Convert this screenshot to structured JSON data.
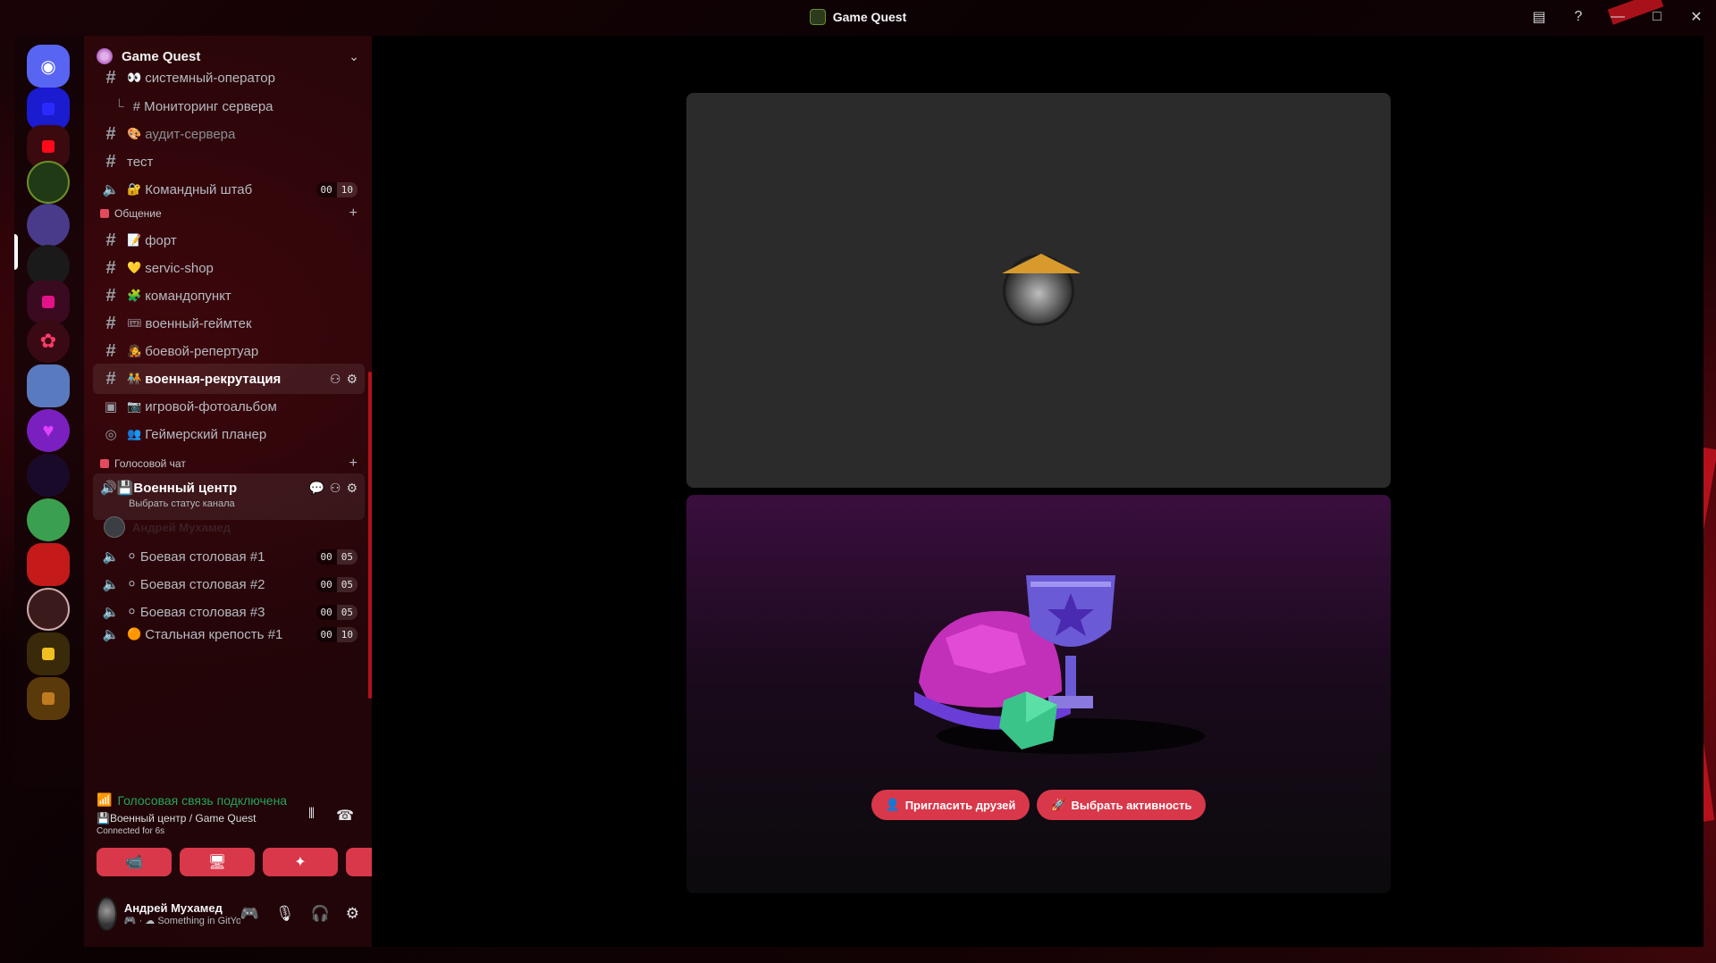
{
  "window": {
    "title": "Game Quest"
  },
  "server": {
    "name": "Game Quest"
  },
  "channels_top": [
    {
      "type": "text",
      "emoji": "👀",
      "label": "системный-оператор"
    },
    {
      "type": "thread",
      "emoji": "",
      "label": "# Мониторинг сервера"
    },
    {
      "type": "text",
      "emoji": "🎨",
      "label": "аудит-сервера"
    },
    {
      "type": "text",
      "emoji": "",
      "label": "тест"
    },
    {
      "type": "voice",
      "emoji": "🔐",
      "label": "Командный штаб",
      "count_a": "00",
      "count_b": "10"
    }
  ],
  "category_obshchenie": {
    "label": "Общение"
  },
  "channels_obshchenie": [
    {
      "emoji": "📝",
      "label": "форт"
    },
    {
      "emoji": "💛",
      "label": "servic-shop"
    },
    {
      "emoji": "🧩",
      "label": "командопункт"
    },
    {
      "emoji": "🎟",
      "label": "военный-геймтек"
    },
    {
      "emoji": "🧑‍🎤",
      "label": "боевой-репертуар"
    },
    {
      "emoji": "🧑‍🤝‍🧑",
      "label": "военная-рекрутация"
    },
    {
      "emoji": "📷",
      "label": "игровой-фотоальбом"
    },
    {
      "emoji": "👥",
      "label": "Геймерский планер"
    }
  ],
  "category_voice": {
    "label": "Голосовой чат"
  },
  "active_voice": {
    "emoji": "💾",
    "label": "Военный центр",
    "status_hint": "Выбрать статус канала",
    "member": "Андрей Мухамед"
  },
  "voice_channels": [
    {
      "emoji": "⚪",
      "label": "Боевая столовая #1",
      "count_a": "00",
      "count_b": "05"
    },
    {
      "emoji": "⚪",
      "label": "Боевая столовая #2",
      "count_a": "00",
      "count_b": "05"
    },
    {
      "emoji": "⚪",
      "label": "Боевая столовая #3",
      "count_a": "00",
      "count_b": "05"
    },
    {
      "emoji": "🟠",
      "label": "Стальная крепость #1",
      "count_a": "00",
      "count_b": "10"
    }
  ],
  "voice_panel": {
    "status": "Голосовая связь подключена",
    "channel": "💾Военный центр / Game Quest",
    "time": "Connected for 6s"
  },
  "user": {
    "name": "Андрей Мухамед",
    "status": "🎮 · ☁ Something in GitYouTu..."
  },
  "activity": {
    "invite_label": "Пригласить друзей",
    "choose_label": "Выбрать активность"
  },
  "colors": {
    "accent": "#d8384a",
    "voice_connected": "#23a55a"
  }
}
